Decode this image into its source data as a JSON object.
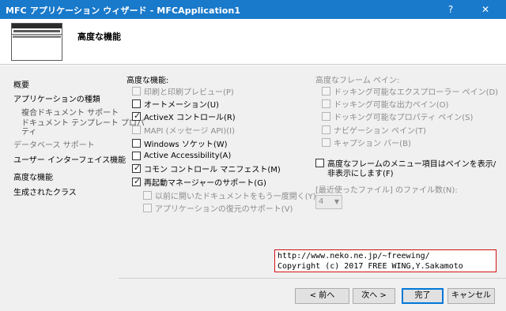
{
  "window": {
    "title": "MFC アプリケーション ウィザード - MFCApplication1",
    "help_icon": "?",
    "close_icon": "✕"
  },
  "header": {
    "heading": "高度な機能"
  },
  "nav": {
    "items": [
      {
        "label": "概要"
      },
      {
        "label": "アプリケーションの種類"
      },
      {
        "label": "複合ドキュメント サポート"
      },
      {
        "label": "ドキュメント テンプレート プロパ"
      },
      {
        "label": "ティ"
      },
      {
        "label": "データベース サポート"
      },
      {
        "label": "ユーザー インターフェイス機能"
      },
      {
        "label": "高度な機能"
      },
      {
        "label": "生成されたクラス"
      }
    ]
  },
  "left_group": {
    "label": "高度な機能:",
    "options": [
      {
        "label": "印刷と印刷プレビュー(P)",
        "checked": false,
        "enabled": false
      },
      {
        "label": "オートメーション(U)",
        "checked": false,
        "enabled": true
      },
      {
        "label": "ActiveX コントロール(R)",
        "checked": true,
        "enabled": true
      },
      {
        "label": "MAPI (メッセージ API)(I)",
        "checked": false,
        "enabled": false
      },
      {
        "label": "Windows ソケット(W)",
        "checked": false,
        "enabled": true
      },
      {
        "label": "Active Accessibility(A)",
        "checked": false,
        "enabled": true
      },
      {
        "label": "コモン コントロール マニフェスト(M)",
        "checked": true,
        "enabled": true
      },
      {
        "label": "再起動マネージャーのサポート(G)",
        "checked": true,
        "enabled": true
      },
      {
        "label": "以前に開いたドキュメントをもう一度開く(Y)",
        "checked": false,
        "enabled": false
      },
      {
        "label": "アプリケーションの復元のサポート(V)",
        "checked": false,
        "enabled": false
      }
    ]
  },
  "right_group": {
    "label": "高度なフレーム ペイン:",
    "options": [
      {
        "label": "ドッキング可能なエクスプローラー ペイン(D)",
        "checked": false,
        "enabled": false
      },
      {
        "label": "ドッキング可能な出力ペイン(O)",
        "checked": false,
        "enabled": false
      },
      {
        "label": "ドッキング可能なプロパティ ペイン(S)",
        "checked": false,
        "enabled": false
      },
      {
        "label": "ナビゲーション ペイン(T)",
        "checked": false,
        "enabled": false
      },
      {
        "label": "キャプション バー(B)",
        "checked": false,
        "enabled": false
      }
    ],
    "menu_option_line1": "高度なフレームのメニュー項目はペインを表示/",
    "menu_option_line2": "非表示にします(F)",
    "mru_label": "[最近使ったファイル] のファイル数(N):",
    "mru_value": "4"
  },
  "watermark": {
    "line1": "http://www.neko.ne.jp/~freewing/",
    "line2": "Copyright (c) 2017 FREE WING,Y.Sakamoto"
  },
  "buttons": {
    "back": "< 前へ",
    "next": "次へ >",
    "finish": "完了",
    "cancel": "キャンセル"
  }
}
